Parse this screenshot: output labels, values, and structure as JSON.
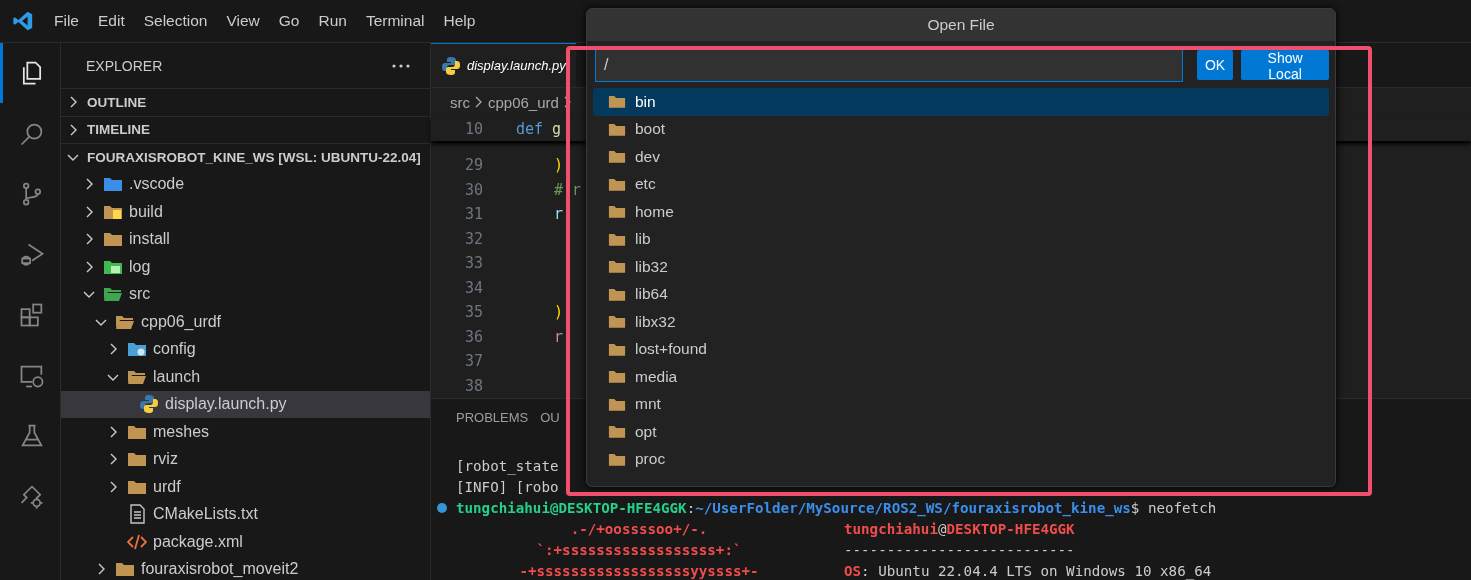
{
  "menu": [
    "File",
    "Edit",
    "Selection",
    "View",
    "Go",
    "Run",
    "Terminal",
    "Help"
  ],
  "activity_bar": [
    {
      "kind": "explorer",
      "selected": true
    },
    {
      "kind": "search",
      "selected": false
    },
    {
      "kind": "source-control",
      "selected": false
    },
    {
      "kind": "run-debug",
      "selected": false
    },
    {
      "kind": "extensions",
      "selected": false
    },
    {
      "kind": "remote",
      "selected": false
    },
    {
      "kind": "testing",
      "selected": false
    },
    {
      "kind": "robot",
      "selected": false
    }
  ],
  "explorer": {
    "title": "EXPLORER",
    "sections": [
      {
        "label": "OUTLINE",
        "expanded": false
      },
      {
        "label": "TIMELINE",
        "expanded": false
      },
      {
        "label": "FOURAXISROBOT_KINE_WS [WSL: UBUNTU-22.04]",
        "expanded": true
      }
    ],
    "tree": [
      {
        "name": ".vscode",
        "kind": "vscode-folder",
        "expanded": false,
        "selected": false
      },
      {
        "name": "build",
        "kind": "build-folder",
        "expanded": false,
        "selected": false
      },
      {
        "name": "install",
        "kind": "folder",
        "expanded": false,
        "selected": false
      },
      {
        "name": "log",
        "kind": "log-folder",
        "expanded": false,
        "selected": false
      },
      {
        "name": "src",
        "kind": "src-folder",
        "expanded": true,
        "selected": false,
        "children": [
          {
            "name": "cpp06_urdf",
            "kind": "folder",
            "expanded": true,
            "selected": false,
            "children": [
              {
                "name": "config",
                "kind": "config-folder",
                "expanded": false,
                "selected": false
              },
              {
                "name": "launch",
                "kind": "folder",
                "expanded": true,
                "selected": false,
                "children": [
                  {
                    "name": "display.launch.py",
                    "kind": "python",
                    "selected": true
                  }
                ]
              },
              {
                "name": "meshes",
                "kind": "folder",
                "expanded": false,
                "selected": false
              },
              {
                "name": "rviz",
                "kind": "folder",
                "expanded": false,
                "selected": false
              },
              {
                "name": "urdf",
                "kind": "folder",
                "expanded": false,
                "selected": false
              },
              {
                "name": "CMakeLists.txt",
                "kind": "text",
                "selected": false
              },
              {
                "name": "package.xml",
                "kind": "xml",
                "selected": false
              }
            ]
          },
          {
            "name": "fouraxisrobot_moveit2",
            "kind": "folder",
            "expanded": false,
            "selected": false
          }
        ]
      }
    ]
  },
  "editor": {
    "tab": {
      "label": "display.launch.py"
    },
    "breadcrumb": [
      "src",
      "cpp06_urd"
    ],
    "sticky_line": {
      "number": "10",
      "tokens": [
        {
          "text": "def",
          "kind": "keyword"
        },
        {
          "text": "g",
          "kind": "function"
        }
      ]
    },
    "lines": [
      {
        "number": "29",
        "tokens": [
          {
            "text": ")",
            "kind": "bracket"
          }
        ]
      },
      {
        "number": "30",
        "tokens": [
          {
            "text": "# r",
            "kind": "comment"
          }
        ]
      },
      {
        "number": "31",
        "tokens": [
          {
            "text": "r",
            "kind": "variable"
          }
        ]
      },
      {
        "number": "32"
      },
      {
        "number": "33"
      },
      {
        "number": "34"
      },
      {
        "number": "35",
        "tokens": [
          {
            "text": ")",
            "kind": "bracket"
          }
        ]
      },
      {
        "number": "36",
        "tokens": [
          {
            "text": "r",
            "kind": "control"
          }
        ]
      },
      {
        "number": "37"
      },
      {
        "number": "38"
      }
    ]
  },
  "panel": {
    "tabs": [
      {
        "label": "PROBLEMS",
        "selected": false
      },
      {
        "label": "OU",
        "selected": false
      }
    ],
    "terminal": [
      {
        "kind": "log",
        "segments": [
          {
            "text": "[robot_state",
            "kind": "plain"
          }
        ]
      },
      {
        "kind": "log",
        "segments": [
          {
            "text": "[INFO] [robo",
            "kind": "plain"
          }
        ]
      },
      {
        "kind": "prompt",
        "segments": [
          {
            "text": "tungchiahui@DESKTOP-HFE4GGK",
            "kind": "user"
          },
          {
            "text": ":",
            "kind": "plain"
          },
          {
            "text": "~/UserFolder/MySource/ROS2_WS/fouraxisrobot_kine_ws",
            "kind": "path"
          },
          {
            "text": "$ neofetch",
            "kind": "plain"
          }
        ]
      },
      {
        "kind": "neofetch",
        "art": ".-/+oossssoo+/-.",
        "segments": [
          {
            "text": "tungchiahui",
            "kind": "red"
          },
          {
            "text": "@",
            "kind": "plain"
          },
          {
            "text": "DESKTOP-HFE4GGK",
            "kind": "red"
          }
        ]
      },
      {
        "kind": "neofetch",
        "art": "`:+ssssssssssssssssss+:`",
        "segments": [
          {
            "text": "---------------------------",
            "kind": "plain"
          }
        ]
      },
      {
        "kind": "neofetch",
        "art": "-+ssssssssssssssssssyyssss+-",
        "segments": [
          {
            "text": "OS",
            "kind": "red"
          },
          {
            "text": ": Ubuntu 22.04.4 LTS on Windows 10 x86_64",
            "kind": "plain"
          }
        ]
      }
    ]
  },
  "dialog": {
    "title": "Open File",
    "path": "/",
    "buttons": [
      "OK",
      "Show Local"
    ],
    "items": [
      {
        "name": "bin",
        "selected": true
      },
      {
        "name": "boot",
        "selected": false
      },
      {
        "name": "dev",
        "selected": false
      },
      {
        "name": "etc",
        "selected": false
      },
      {
        "name": "home",
        "selected": false
      },
      {
        "name": "lib",
        "selected": false
      },
      {
        "name": "lib32",
        "selected": false
      },
      {
        "name": "lib64",
        "selected": false
      },
      {
        "name": "libx32",
        "selected": false
      },
      {
        "name": "lost+found",
        "selected": false
      },
      {
        "name": "media",
        "selected": false
      },
      {
        "name": "mnt",
        "selected": false
      },
      {
        "name": "opt",
        "selected": false
      },
      {
        "name": "proc",
        "selected": false
      }
    ]
  }
}
